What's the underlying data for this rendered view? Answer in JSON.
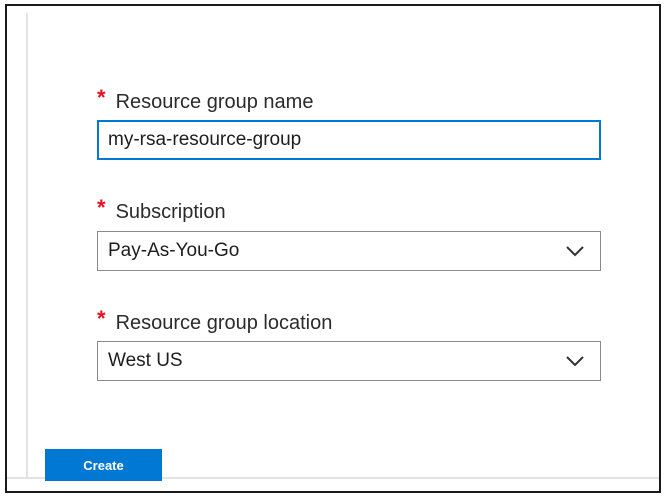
{
  "form": {
    "required_marker": "*",
    "resource_group_name": {
      "label": "Resource group name",
      "value": "my-rsa-resource-group"
    },
    "subscription": {
      "label": "Subscription",
      "selected": "Pay-As-You-Go"
    },
    "location": {
      "label": "Resource group location",
      "selected": "West US"
    },
    "create_label": "Create"
  },
  "colors": {
    "accent": "#0078d4",
    "required": "#e81123",
    "border": "#8a8a8a",
    "frame": "#1a1a1a"
  },
  "icons": {
    "dropdown": "chevron-down-icon"
  }
}
